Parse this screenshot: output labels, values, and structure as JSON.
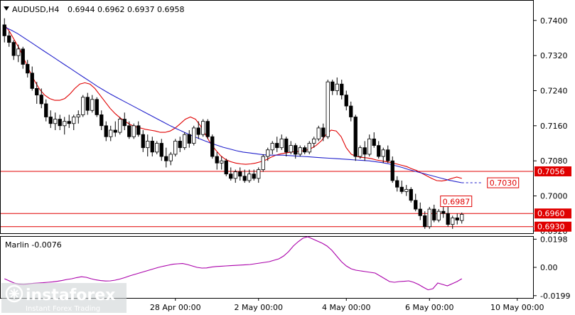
{
  "header": {
    "symbol": "AUDUSD,H4",
    "ohlc": "0.6944 0.6962 0.6937 0.6958"
  },
  "indicator": {
    "label": "Marlin -0.0076"
  },
  "watermark": {
    "brand": "instaforex",
    "tagline": "Instant Forex Trading"
  },
  "chart_data": {
    "type": "candlestick",
    "price_ylim": [
      0.6915,
      0.7445
    ],
    "price_ticks": [
      "0.7400",
      "0.7320",
      "0.7240",
      "0.7160",
      "0.7080",
      "0.7000",
      "0.6920"
    ],
    "indicator_ylim": [
      -0.0215,
      0.0215
    ],
    "indicator_ticks": [
      "0.0198",
      "0.00",
      "-0.0199"
    ],
    "x_labels": [
      "28 Apr 00:00",
      "2 May 00:00",
      "4 May 00:00",
      "6 May 00:00",
      "10 May 00:00"
    ],
    "x_label_candle_index": [
      37,
      55,
      74,
      92,
      111
    ],
    "colors": {
      "bull": "#ffffff",
      "bear": "#000000",
      "ma_fast": "#e00000",
      "ma_slow": "#2222cc",
      "level": "#e00000",
      "oscillator": "#aa00aa"
    },
    "levels": [
      {
        "value": 0.7056,
        "label": "0.7056"
      },
      {
        "value": 0.696,
        "label": "0.6960"
      },
      {
        "value": 0.693,
        "label": "0.6930"
      }
    ],
    "annotations": [
      {
        "label": "0.7030",
        "value": 0.703,
        "style": "dashed-blue-arrow"
      },
      {
        "label": "0.6987",
        "value": 0.6987,
        "style": "red-box"
      }
    ],
    "candles": [
      [
        0.739,
        0.7405,
        0.735,
        0.7365
      ],
      [
        0.7365,
        0.7375,
        0.734,
        0.735
      ],
      [
        0.735,
        0.7355,
        0.731,
        0.732
      ],
      [
        0.732,
        0.7345,
        0.7305,
        0.7335
      ],
      [
        0.7335,
        0.734,
        0.729,
        0.73
      ],
      [
        0.73,
        0.731,
        0.727,
        0.728
      ],
      [
        0.728,
        0.7295,
        0.724,
        0.7245
      ],
      [
        0.7245,
        0.726,
        0.721,
        0.723
      ],
      [
        0.723,
        0.7245,
        0.72,
        0.721
      ],
      [
        0.721,
        0.722,
        0.717,
        0.718
      ],
      [
        0.718,
        0.7195,
        0.7155,
        0.7165
      ],
      [
        0.7165,
        0.719,
        0.715,
        0.7175
      ],
      [
        0.7175,
        0.7185,
        0.715,
        0.716
      ],
      [
        0.716,
        0.718,
        0.714,
        0.717
      ],
      [
        0.717,
        0.7185,
        0.7155,
        0.7165
      ],
      [
        0.7165,
        0.7185,
        0.715,
        0.718
      ],
      [
        0.718,
        0.7195,
        0.7165,
        0.7185
      ],
      [
        0.7185,
        0.723,
        0.718,
        0.7225
      ],
      [
        0.7225,
        0.7235,
        0.7185,
        0.7195
      ],
      [
        0.7195,
        0.723,
        0.719,
        0.722
      ],
      [
        0.722,
        0.7225,
        0.718,
        0.7185
      ],
      [
        0.7185,
        0.7195,
        0.715,
        0.716
      ],
      [
        0.716,
        0.717,
        0.7125,
        0.7135
      ],
      [
        0.7135,
        0.716,
        0.7125,
        0.715
      ],
      [
        0.715,
        0.717,
        0.7135,
        0.7145
      ],
      [
        0.7145,
        0.718,
        0.714,
        0.7175
      ],
      [
        0.7175,
        0.719,
        0.715,
        0.716
      ],
      [
        0.716,
        0.717,
        0.713,
        0.7135
      ],
      [
        0.7135,
        0.7165,
        0.713,
        0.716
      ],
      [
        0.716,
        0.717,
        0.7135,
        0.714
      ],
      [
        0.714,
        0.715,
        0.71,
        0.711
      ],
      [
        0.711,
        0.714,
        0.709,
        0.7125
      ],
      [
        0.7125,
        0.7135,
        0.709,
        0.71
      ],
      [
        0.71,
        0.7125,
        0.7095,
        0.712
      ],
      [
        0.712,
        0.713,
        0.708,
        0.709
      ],
      [
        0.709,
        0.711,
        0.7065,
        0.708
      ],
      [
        0.708,
        0.71,
        0.707,
        0.7095
      ],
      [
        0.7095,
        0.713,
        0.709,
        0.7125
      ],
      [
        0.7125,
        0.7135,
        0.71,
        0.711
      ],
      [
        0.711,
        0.7145,
        0.7105,
        0.714
      ],
      [
        0.714,
        0.715,
        0.711,
        0.712
      ],
      [
        0.712,
        0.716,
        0.7115,
        0.7155
      ],
      [
        0.7155,
        0.717,
        0.713,
        0.714
      ],
      [
        0.714,
        0.7175,
        0.7135,
        0.717
      ],
      [
        0.717,
        0.7175,
        0.713,
        0.7135
      ],
      [
        0.7135,
        0.714,
        0.7085,
        0.709
      ],
      [
        0.709,
        0.71,
        0.706,
        0.7075
      ],
      [
        0.7075,
        0.709,
        0.706,
        0.708
      ],
      [
        0.708,
        0.7085,
        0.7045,
        0.705
      ],
      [
        0.705,
        0.7065,
        0.7035,
        0.704
      ],
      [
        0.704,
        0.706,
        0.703,
        0.7055
      ],
      [
        0.7055,
        0.7065,
        0.7035,
        0.7045
      ],
      [
        0.7045,
        0.706,
        0.703,
        0.7035
      ],
      [
        0.7035,
        0.706,
        0.703,
        0.705
      ],
      [
        0.705,
        0.706,
        0.7035,
        0.704
      ],
      [
        0.704,
        0.7065,
        0.703,
        0.706
      ],
      [
        0.706,
        0.7095,
        0.7055,
        0.709
      ],
      [
        0.709,
        0.711,
        0.708,
        0.7105
      ],
      [
        0.7105,
        0.7125,
        0.7095,
        0.712
      ],
      [
        0.712,
        0.7135,
        0.71,
        0.711
      ],
      [
        0.711,
        0.714,
        0.7105,
        0.713
      ],
      [
        0.713,
        0.7135,
        0.709,
        0.71
      ],
      [
        0.71,
        0.7125,
        0.7095,
        0.7115
      ],
      [
        0.7115,
        0.712,
        0.7085,
        0.7095
      ],
      [
        0.7095,
        0.7115,
        0.709,
        0.711
      ],
      [
        0.711,
        0.7115,
        0.7095,
        0.71
      ],
      [
        0.71,
        0.7125,
        0.7095,
        0.712
      ],
      [
        0.712,
        0.7135,
        0.711,
        0.713
      ],
      [
        0.713,
        0.716,
        0.7125,
        0.7155
      ],
      [
        0.7155,
        0.7165,
        0.7125,
        0.7135
      ],
      [
        0.7135,
        0.7265,
        0.713,
        0.726
      ],
      [
        0.726,
        0.7265,
        0.723,
        0.724
      ],
      [
        0.724,
        0.727,
        0.723,
        0.7255
      ],
      [
        0.7255,
        0.7265,
        0.722,
        0.723
      ],
      [
        0.723,
        0.724,
        0.7195,
        0.7205
      ],
      [
        0.7205,
        0.7215,
        0.717,
        0.718
      ],
      [
        0.718,
        0.7185,
        0.708,
        0.709
      ],
      [
        0.709,
        0.7115,
        0.7085,
        0.711
      ],
      [
        0.711,
        0.7125,
        0.708,
        0.7095
      ],
      [
        0.7095,
        0.714,
        0.709,
        0.713
      ],
      [
        0.713,
        0.7145,
        0.711,
        0.7115
      ],
      [
        0.7115,
        0.7125,
        0.7085,
        0.709
      ],
      [
        0.709,
        0.711,
        0.7075,
        0.7105
      ],
      [
        0.7105,
        0.7115,
        0.7075,
        0.708
      ],
      [
        0.708,
        0.709,
        0.703,
        0.7035
      ],
      [
        0.7035,
        0.7045,
        0.701,
        0.702
      ],
      [
        0.702,
        0.7035,
        0.7005,
        0.701
      ],
      [
        0.701,
        0.7025,
        0.7,
        0.7015
      ],
      [
        0.7015,
        0.702,
        0.6985,
        0.699
      ],
      [
        0.699,
        0.7005,
        0.6965,
        0.697
      ],
      [
        0.697,
        0.6985,
        0.6945,
        0.6955
      ],
      [
        0.6955,
        0.6965,
        0.6925,
        0.693
      ],
      [
        0.693,
        0.6975,
        0.6925,
        0.697
      ],
      [
        0.697,
        0.698,
        0.694,
        0.6945
      ],
      [
        0.6945,
        0.697,
        0.694,
        0.6965
      ],
      [
        0.6965,
        0.6987,
        0.695,
        0.696
      ],
      [
        0.696,
        0.6975,
        0.693,
        0.6935
      ],
      [
        0.6935,
        0.6955,
        0.6925,
        0.695
      ],
      [
        0.695,
        0.696,
        0.6935,
        0.6945
      ],
      [
        0.6944,
        0.6962,
        0.6937,
        0.6958
      ]
    ],
    "ma_fast": [
      0.739,
      0.7375,
      0.7355,
      0.7335,
      0.731,
      0.7285,
      0.7262,
      0.7243,
      0.723,
      0.7222,
      0.7218,
      0.7218,
      0.7222,
      0.7232,
      0.7245,
      0.7255,
      0.7258,
      0.7255,
      0.7245,
      0.723,
      0.7215,
      0.72,
      0.7188,
      0.7178,
      0.717,
      0.7163,
      0.7158,
      0.7155,
      0.7152,
      0.715,
      0.7148,
      0.7145,
      0.7145,
      0.7148,
      0.7155,
      0.7165,
      0.7175,
      0.718,
      0.7175,
      0.716,
      0.714,
      0.712,
      0.7105,
      0.7092,
      0.7083,
      0.7078,
      0.7075,
      0.7073,
      0.7072,
      0.7073,
      0.7075,
      0.7078,
      0.7082,
      0.7088,
      0.7093,
      0.7096,
      0.7098,
      0.71,
      0.7101,
      0.7102,
      0.7104,
      0.7108,
      0.7115,
      0.7125,
      0.714,
      0.715,
      0.7148,
      0.7135,
      0.711,
      0.7095,
      0.709,
      0.7088,
      0.7087,
      0.7085,
      0.7082,
      0.708,
      0.7078,
      0.7076,
      0.7073,
      0.707,
      0.7067,
      0.7062,
      0.7058,
      0.7052,
      0.7046,
      0.704,
      0.7035,
      0.7034,
      0.7036,
      0.704,
      0.7043,
      0.704
    ],
    "ma_slow": [
      0.7385,
      0.7378,
      0.737,
      0.736,
      0.735,
      0.734,
      0.733,
      0.732,
      0.731,
      0.73,
      0.729,
      0.728,
      0.727,
      0.726,
      0.725,
      0.7241,
      0.7232,
      0.7224,
      0.7216,
      0.7208,
      0.72,
      0.7192,
      0.7184,
      0.7176,
      0.7168,
      0.716,
      0.7153,
      0.7146,
      0.7139,
      0.7133,
      0.7127,
      0.7121,
      0.7116,
      0.7111,
      0.7107,
      0.7103,
      0.71,
      0.7098,
      0.7096,
      0.7094,
      0.7093,
      0.7093,
      0.7093,
      0.7092,
      0.7091,
      0.709,
      0.7089,
      0.7088,
      0.7087,
      0.7086,
      0.7085,
      0.7084,
      0.7083,
      0.7082,
      0.7081,
      0.708,
      0.7078,
      0.7076,
      0.7073,
      0.7069,
      0.7065,
      0.706,
      0.7056,
      0.7052,
      0.7048,
      0.7044,
      0.704,
      0.7036,
      0.7033,
      0.703
    ],
    "ma_slow_projection": [
      0.703,
      0.703
    ],
    "oscillator": [
      -0.008,
      -0.0095,
      -0.011,
      -0.0118,
      -0.012,
      -0.0116,
      -0.0112,
      -0.011,
      -0.0108,
      -0.0105,
      -0.0102,
      -0.0098,
      -0.0092,
      -0.0085,
      -0.008,
      -0.0072,
      -0.0066,
      -0.007,
      -0.008,
      -0.0088,
      -0.0093,
      -0.0096,
      -0.0095,
      -0.009,
      -0.0082,
      -0.0072,
      -0.006,
      -0.005,
      -0.004,
      -0.003,
      -0.002,
      -0.001,
      0.0,
      0.0008,
      0.0015,
      0.0022,
      0.0025,
      0.0027,
      0.002,
      0.001,
      0.0,
      -0.0005,
      -0.0004,
      0.0002,
      0.0006,
      0.0008,
      0.001,
      0.0012,
      0.0014,
      0.0016,
      0.0018,
      0.002,
      0.0025,
      0.003,
      0.0035,
      0.004,
      0.005,
      0.006,
      0.008,
      0.011,
      0.015,
      0.018,
      0.0205,
      0.0215,
      0.02,
      0.0185,
      0.017,
      0.015,
      0.012,
      0.008,
      0.004,
      0.001,
      -0.001,
      -0.002,
      -0.0025,
      -0.003,
      -0.0035,
      -0.004,
      -0.006,
      -0.008,
      -0.01,
      -0.0105,
      -0.01,
      -0.0098,
      -0.0095,
      -0.0105,
      -0.012,
      -0.014,
      -0.0158,
      -0.015,
      -0.011,
      -0.012,
      -0.013,
      -0.0115,
      -0.01,
      -0.008
    ]
  }
}
